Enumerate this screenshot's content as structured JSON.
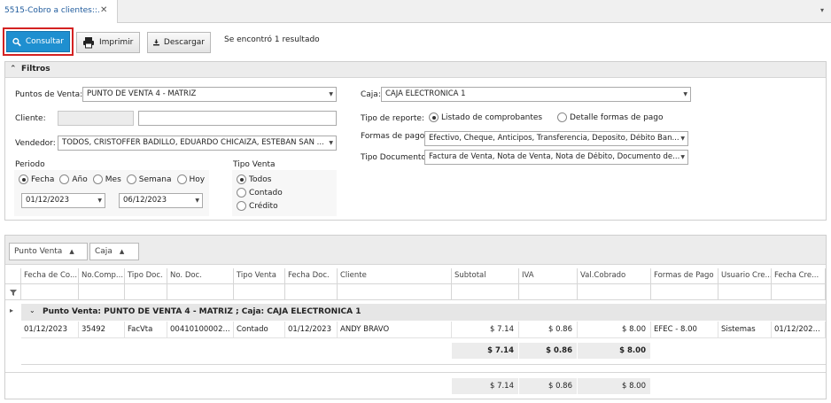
{
  "tab": {
    "title": "5515-Cobro a clientes::.",
    "close": "✕",
    "menu": "▾"
  },
  "toolbar": {
    "consultar": "Consultar",
    "imprimir": "Imprimir",
    "descargar": "Descargar",
    "result_text": "Se encontró 1 resultado"
  },
  "filters": {
    "header": "Filtros",
    "puntos_venta_label": "Puntos de Venta:",
    "puntos_venta_value": "PUNTO DE VENTA 4 - MATRIZ",
    "cliente_label": "Cliente:",
    "cliente_code": "",
    "cliente_name": "",
    "vendedor_label": "Vendedor:",
    "vendedor_value": "TODOS, CRISTOFFER BADILLO, EDUARDO CHICAIZA, ESTEBAN SAN ...",
    "periodo_label": "Periodo",
    "periodo_options": [
      "Fecha",
      "Año",
      "Mes",
      "Semana",
      "Hoy"
    ],
    "periodo_selected": "Fecha",
    "fecha_desde": "01/12/2023",
    "fecha_hasta": "06/12/2023",
    "tipo_venta_label": "Tipo Venta",
    "tipo_venta_options": [
      "Todos",
      "Contado",
      "Crédito"
    ],
    "tipo_venta_selected": "Todos",
    "caja_label": "Caja:",
    "caja_value": "CAJA ELECTRONICA 1",
    "tipo_reporte_label": "Tipo de reporte:",
    "tipo_reporte_options": [
      "Listado de comprobantes",
      "Detalle formas de pago"
    ],
    "tipo_reporte_selected": "Listado de comprobantes",
    "formas_pago_label": "Formas de pago",
    "formas_pago_value": "Efectivo, Cheque, Anticipos, Transferencia, Deposito, Débito Ban...",
    "tipo_documento_label": "Tipo Documento",
    "tipo_documento_value": "Factura de Venta, Nota de Venta, Nota de Débito, Documento de..."
  },
  "grid": {
    "group_chips": [
      "Punto Venta",
      "Caja"
    ],
    "columns": [
      "Fecha de Co...",
      "No.Comp...",
      "Tipo Doc.",
      "No. Doc.",
      "Tipo Venta",
      "Fecha Doc.",
      "Cliente",
      "Subtotal",
      "IVA",
      "Val.Cobrado",
      "Formas de Pago",
      "Usuario Cre...",
      "Fecha Cre..."
    ],
    "group_row": "Punto Venta: PUNTO DE VENTA 4 - MATRIZ ; Caja: CAJA ELECTRONICA 1",
    "rows": [
      [
        "01/12/2023",
        "35492",
        "FacVta",
        "00410100002...",
        "Contado",
        "01/12/2023",
        "ANDY BRAVO",
        "$ 7.14",
        "$ 0.86",
        "$ 8.00",
        "EFEC - 8.00",
        "Sistemas",
        "01/12/202..."
      ]
    ],
    "group_totals": {
      "subtotal": "$ 7.14",
      "iva": "$ 0.86",
      "cobrado": "$ 8.00"
    },
    "grand_totals": {
      "subtotal": "$ 7.14",
      "iva": "$ 0.86",
      "cobrado": "$ 8.00"
    }
  },
  "colors": {
    "accent": "#1e8fd0",
    "highlight_border": "#d42222",
    "tab_text": "#1e5a9c"
  }
}
